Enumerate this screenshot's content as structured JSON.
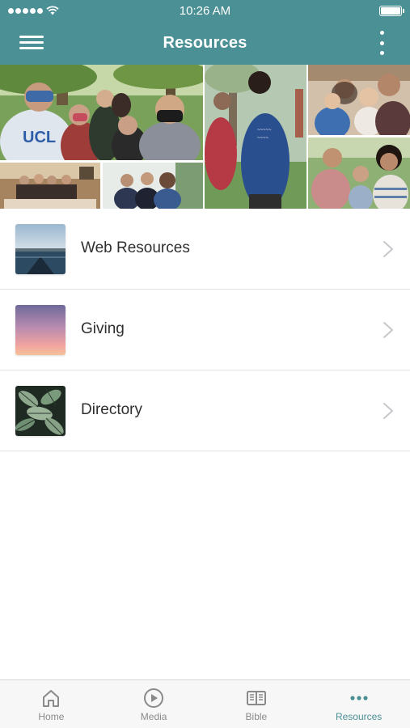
{
  "status_bar": {
    "time": "10:26 AM",
    "signal_icon": "signal-dots-icon",
    "wifi_icon": "wifi-icon",
    "battery_icon": "battery-icon"
  },
  "header": {
    "title": "Resources",
    "menu_icon": "hamburger-menu-icon",
    "more_icon": "vertical-more-icon",
    "background_color": "#4a9095"
  },
  "resources": [
    {
      "label": "Web Resources",
      "thumbnail": "lake-boat-thumbnail"
    },
    {
      "label": "Giving",
      "thumbnail": "sunset-sky-thumbnail"
    },
    {
      "label": "Directory",
      "thumbnail": "leaves-thumbnail"
    }
  ],
  "tab_bar": {
    "active_color": "#4a9095",
    "tabs": [
      {
        "label": "Home",
        "icon": "house-icon",
        "active": false
      },
      {
        "label": "Media",
        "icon": "play-circle-icon",
        "active": false
      },
      {
        "label": "Bible",
        "icon": "open-book-icon",
        "active": false
      },
      {
        "label": "Resources",
        "icon": "more-dots-icon",
        "active": true
      }
    ]
  }
}
